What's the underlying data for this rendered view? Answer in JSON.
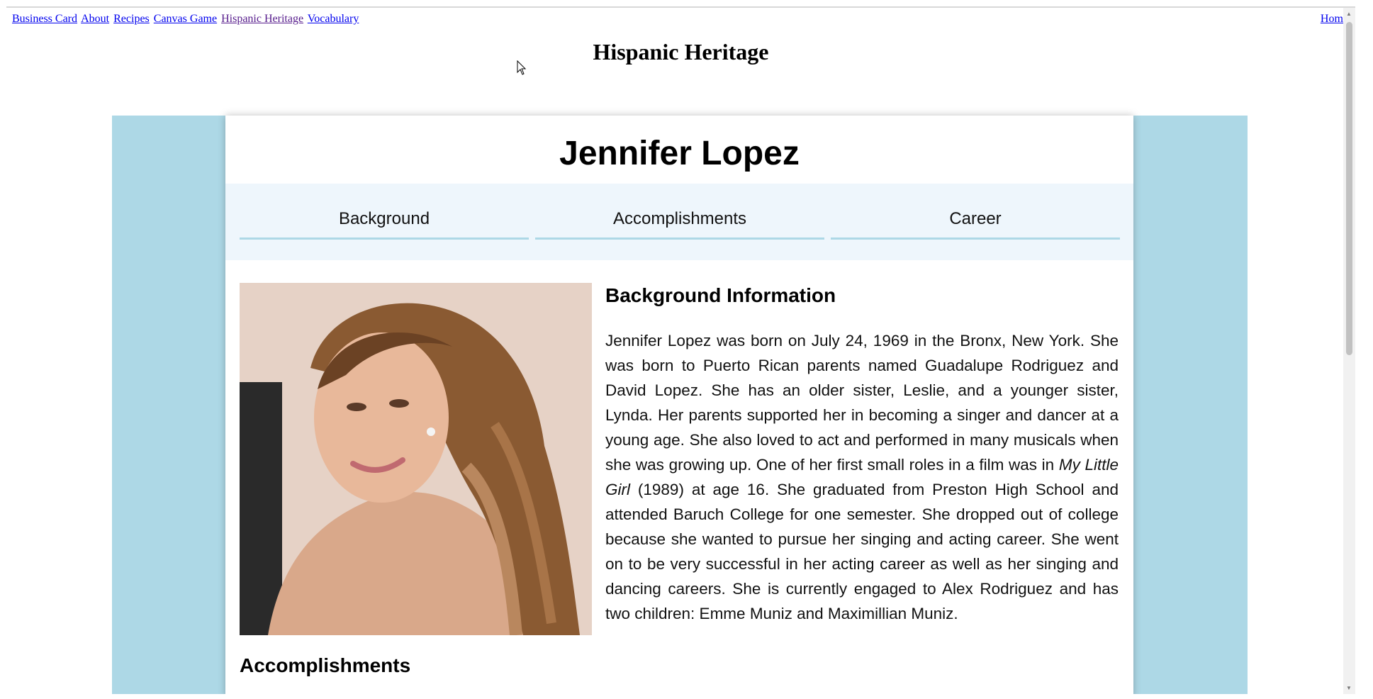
{
  "nav": {
    "links": [
      "Business Card",
      "About",
      "Recipes",
      "Canvas Game",
      "Hispanic Heritage",
      "Vocabulary"
    ],
    "home": "Home"
  },
  "page": {
    "title": "Hispanic Heritage"
  },
  "card": {
    "name": "Jennifer Lopez",
    "tabs": [
      "Background",
      "Accomplishments",
      "Career"
    ],
    "background_heading": "Background Information",
    "background_text_1": "Jennifer Lopez was born on July 24, 1969 in the Bronx, New York. She was born to Puerto Rican parents named Guadalupe Rodriguez and David Lopez. She has an older sister, Leslie, and a younger sister, Lynda. Her parents supported her in becoming a singer and dancer at a young age. She also loved to act and performed in many musicals when she was growing up. One of her first small roles in a film was in ",
    "film_title": "My Little Girl",
    "background_text_2": " (1989) at age 16. She graduated from Preston High School and attended Baruch College for one semester. She dropped out of college because she wanted to pursue her singing and acting career. She went on to be very successful in her acting career as well as her singing and dancing careers. She is currently engaged to Alex Rodriguez and has two children: Emme Muniz and Maximillian Muniz.",
    "accomplishments_heading": "Accomplishments"
  },
  "colors": {
    "band": "#add8e6",
    "tab_bg": "#eef6fc",
    "tab_underline": "#add8e6"
  }
}
